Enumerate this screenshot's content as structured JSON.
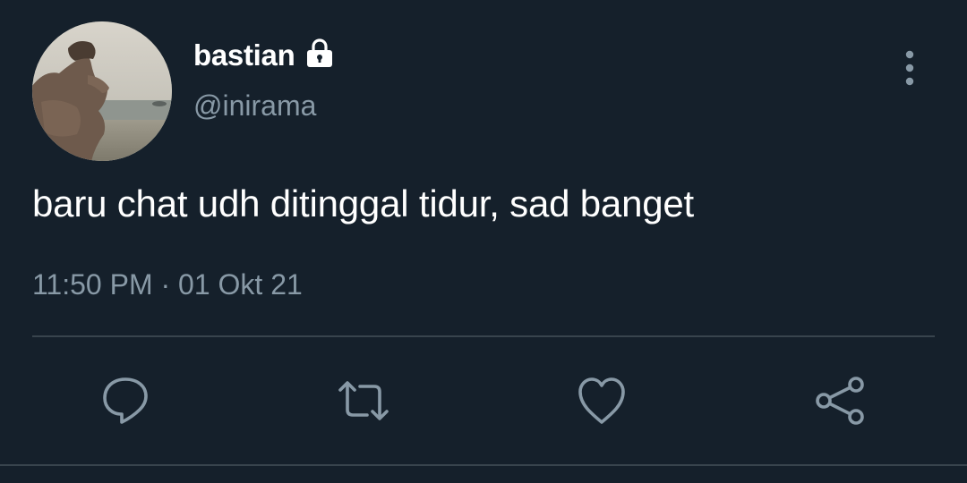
{
  "user": {
    "display_name": "bastian",
    "username": "@inirama",
    "protected_icon": "lock-icon",
    "avatar": "profile-photo"
  },
  "tweet": {
    "text": "baru chat udh ditinggal tidur, sad banget",
    "time": "11:50 PM",
    "separator": "·",
    "date": "01 Okt 21"
  },
  "actions": {
    "reply_icon": "speech-bubble-icon",
    "retweet_icon": "retweet-icon",
    "like_icon": "heart-icon",
    "share_icon": "share-icon",
    "more_icon": "vertical-ellipsis-icon"
  },
  "colors": {
    "background": "#15202b",
    "primary_text": "#ffffff",
    "secondary_text": "#8899a6",
    "divider": "#38444d"
  }
}
